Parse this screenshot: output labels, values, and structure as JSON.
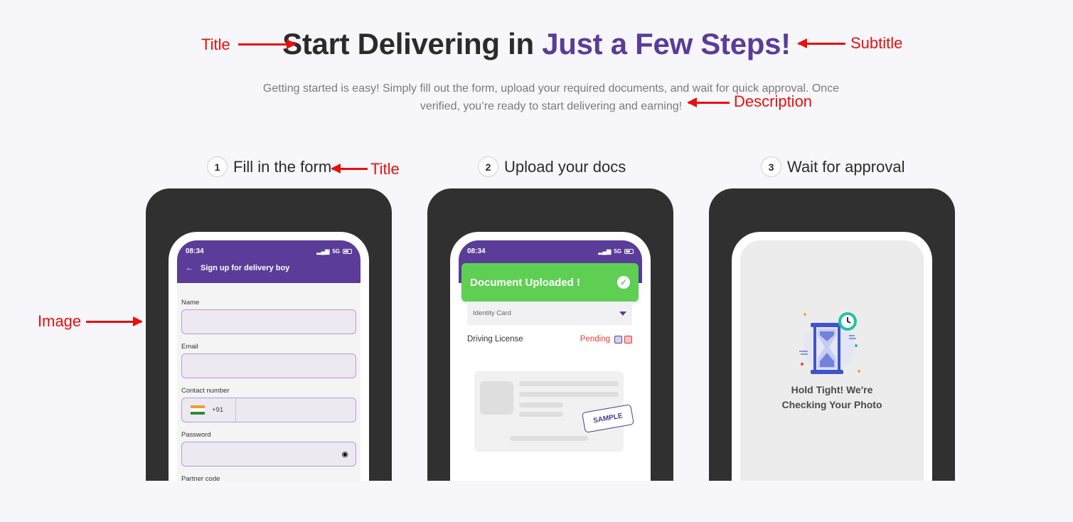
{
  "page": {
    "heading_main": "Start Delivering in ",
    "heading_accent": "Just a Few Steps!",
    "description": "Getting started is easy! Simply fill out the form, upload your required documents, and wait for quick approval. Once verified, you’re ready to start delivering and earning!"
  },
  "annotations": {
    "title": "Title",
    "subtitle": "Subtitle",
    "description": "Description",
    "step_title": "Title",
    "image": "Image"
  },
  "steps": [
    {
      "number": "1",
      "title": "Fill in the form"
    },
    {
      "number": "2",
      "title": "Upload your docs"
    },
    {
      "number": "3",
      "title": "Wait for approval"
    }
  ],
  "phone1": {
    "time": "08:34",
    "network": "5G",
    "screen_title": "Sign up for delivery boy",
    "fields": {
      "name": "Name",
      "email": "Email",
      "contact": "Contact number",
      "country_code": "+91",
      "password": "Password",
      "partner": "Partner code"
    }
  },
  "phone2": {
    "time": "08:34",
    "network": "5G",
    "toast": "Document Uploaded !",
    "dropdown": "Identity Card",
    "doc_label": "Driving License",
    "status": "Pending",
    "stamp": "SAMPLE"
  },
  "phone3": {
    "line1": "Hold Tight! We're",
    "line2": "Checking Your Photo"
  },
  "colors": {
    "accent": "#5b3c98",
    "annotation": "#e8100e",
    "success": "#5fcf54",
    "pending": "#e53935"
  }
}
